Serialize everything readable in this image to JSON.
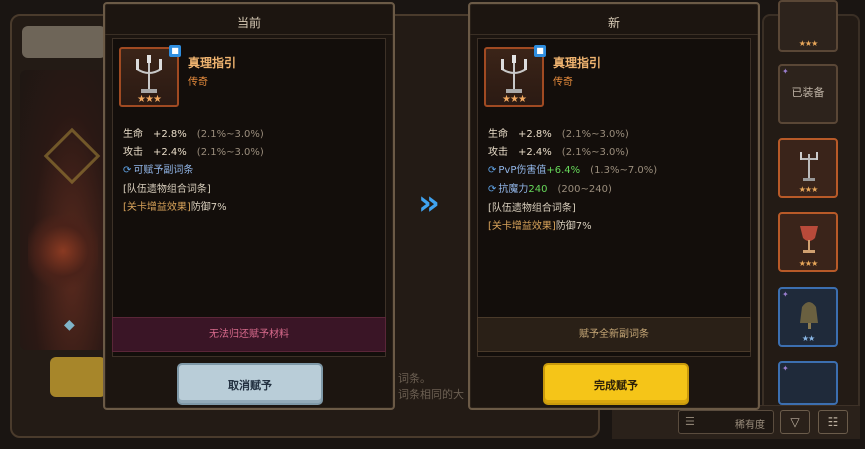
{
  "left_panel": {
    "title": "当前",
    "item_name": "真理指引",
    "item_rarity": "传奇",
    "stars": "★★★",
    "badge": "■",
    "stats": [
      {
        "label": "生命",
        "value": "+2.8%",
        "range": "(2.1%~3.0%)"
      },
      {
        "label": "攻击",
        "value": "+2.4%",
        "range": "(2.1%~3.0%)"
      }
    ],
    "sub_option_hint": "可赋予副词条",
    "set_header": "[队伍遗物组合词条]",
    "set_bonus_bracket": "[关卡增益效果]",
    "set_bonus_text": "防御7%",
    "notice": "无法归还赋予材料",
    "button": "取消赋予"
  },
  "right_panel": {
    "title": "新",
    "item_name": "真理指引",
    "item_rarity": "传奇",
    "stars": "★★★",
    "badge": "■",
    "stats": [
      {
        "label": "生命",
        "value": "+2.8%",
        "range": "(2.1%~3.0%)"
      },
      {
        "label": "攻击",
        "value": "+2.4%",
        "range": "(2.1%~3.0%)"
      }
    ],
    "sub_stats": [
      {
        "label": "PvP伤害值",
        "value": "+6.4%",
        "range": "(1.3%~7.0%)"
      },
      {
        "label": "抗魔力",
        "value": "240",
        "range": "(200~240)"
      }
    ],
    "set_header": "[队伍遗物组合词条]",
    "set_bonus_bracket": "[关卡增益效果]",
    "set_bonus_text": "防御7%",
    "notice": "赋予全新副词条",
    "button": "完成赋予"
  },
  "arrow": "»",
  "background": {
    "ghost_text_1": "词条。",
    "ghost_text_2": "词条相同的大",
    "inventory": {
      "equipped_label": "已装备",
      "rarity_filter": "稀有度",
      "menu_icon": "☰",
      "sort_icon": "▽",
      "filter_icon": "☷",
      "stars": "★★★",
      "blue_stars": "★★"
    }
  },
  "colors": {
    "legendary": "#e48a3c",
    "positive": "#66d85a",
    "confirm": "#f5c518",
    "cancel": "#b9cdd8",
    "arrow": "#3fa3f0"
  }
}
